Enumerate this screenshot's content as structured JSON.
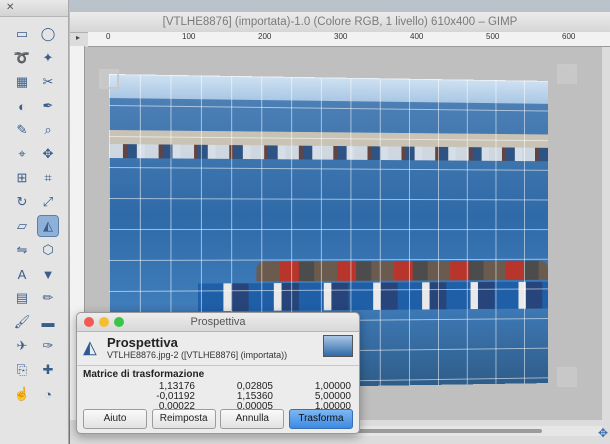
{
  "window": {
    "title": "[VTLHE8876] (importata)-1.0 (Colore RGB, 1 livello) 610x400 – GIMP"
  },
  "ruler": {
    "top_labels": [
      "0",
      "100",
      "200",
      "300",
      "400",
      "500",
      "600"
    ]
  },
  "toolbox": {
    "tools": [
      "rect-select-icon",
      "ellipse-select-icon",
      "lasso-icon",
      "fuzzy-select-icon",
      "color-select-icon",
      "scissors-icon",
      "foreground-select-icon",
      "paths-icon",
      "color-picker-icon",
      "zoom-icon",
      "measure-icon",
      "move-icon",
      "align-icon",
      "crop-icon",
      "rotate-icon",
      "scale-icon",
      "shear-icon",
      "perspective-icon",
      "flip-icon",
      "cage-icon",
      "text-icon",
      "bucket-fill-icon",
      "blend-icon",
      "pencil-icon",
      "paintbrush-icon",
      "eraser-icon",
      "airbrush-icon",
      "ink-icon",
      "clone-icon",
      "heal-icon",
      "smudge-icon",
      "dodge-icon"
    ]
  },
  "dialog": {
    "title": "Prospettiva",
    "tool_name": "Prospettiva",
    "subtitle": "VTLHE8876.jpg-2 ([VTLHE8876] (importata))",
    "section": "Matrice di trasformazione",
    "matrix": [
      [
        "1,13176",
        "0,02805",
        "1,00000"
      ],
      [
        "-0,01192",
        "1,15360",
        "5,00000"
      ],
      [
        "0,00022",
        "0,00005",
        "1,00000"
      ]
    ],
    "buttons": {
      "help": "Aiuto",
      "reset": "Reimposta",
      "cancel": "Annulla",
      "transform": "Trasforma"
    }
  }
}
